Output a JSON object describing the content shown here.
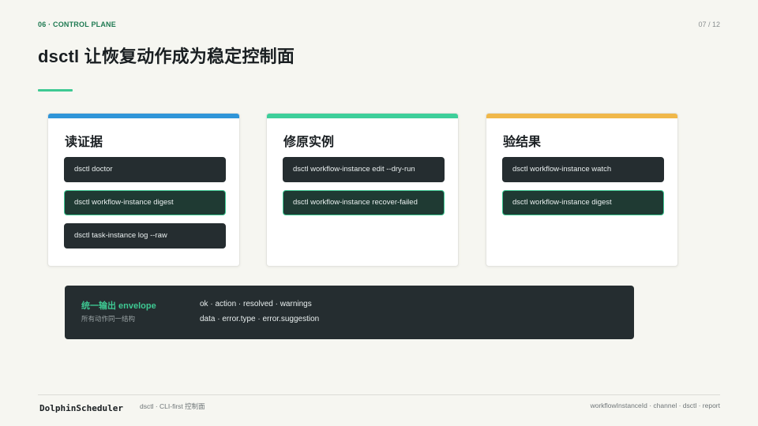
{
  "header": {
    "section_tag": "06 · CONTROL PLANE",
    "page_number": "07 / 12",
    "title": "dsctl 让恢复动作成为稳定控制面"
  },
  "colors": {
    "accent_green": "#3ec993",
    "card_bar_blue": "#2f95d8",
    "card_bar_green": "#3ecf9a",
    "card_bar_yellow": "#f0b84a",
    "dark_panel": "#252d30"
  },
  "cards": [
    {
      "title": "读证据",
      "commands": [
        {
          "label": "dsctl doctor",
          "highlighted": false
        },
        {
          "label": "dsctl workflow-instance digest",
          "highlighted": true
        },
        {
          "label": "dsctl task-instance log --raw",
          "highlighted": false
        }
      ]
    },
    {
      "title": "修原实例",
      "commands": [
        {
          "label": "dsctl workflow-instance edit --dry-run",
          "highlighted": false
        },
        {
          "label": "dsctl workflow-instance recover-failed",
          "highlighted": true
        }
      ]
    },
    {
      "title": "验结果",
      "commands": [
        {
          "label": "dsctl workflow-instance watch",
          "highlighted": false
        },
        {
          "label": "dsctl workflow-instance digest",
          "highlighted": true
        }
      ]
    }
  ],
  "envelope": {
    "title": "统一输出 envelope",
    "subtitle": "所有动作同一结构",
    "line1": "ok · action · resolved · warnings",
    "line2": "data · error.type · error.suggestion"
  },
  "footer": {
    "logo": "DolphinScheduler",
    "note": "dsctl · CLI-first 控制面",
    "right": "workflowInstanceId · channel · dsctl · report"
  }
}
